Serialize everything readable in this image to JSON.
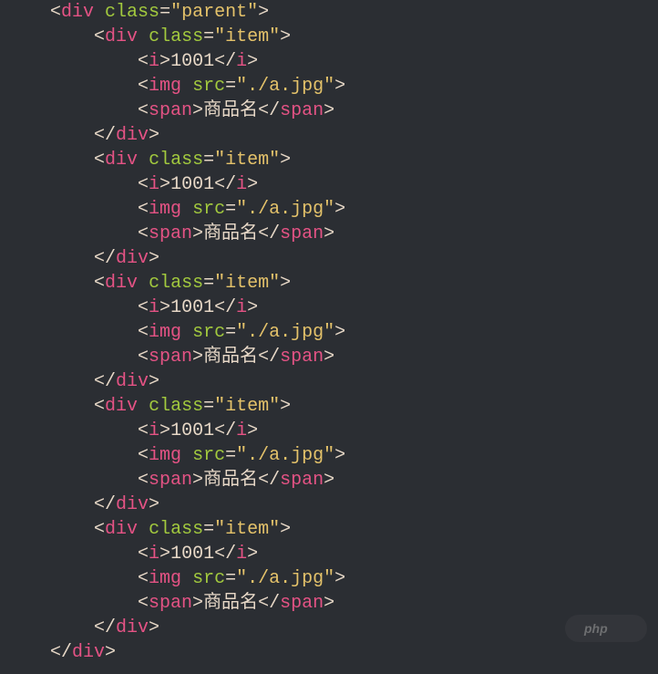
{
  "code": {
    "parent": {
      "tag": "div",
      "attr": "class",
      "val": "\"parent\""
    },
    "items": [
      {
        "tag": "div",
        "attr": "class",
        "val": "\"item\"",
        "i_tag": "i",
        "i_text": "1001",
        "img_tag": "img",
        "img_attr": "src",
        "img_val": "\"./a.jpg\"",
        "span_tag": "span",
        "span_text": "商品名"
      },
      {
        "tag": "div",
        "attr": "class",
        "val": "\"item\"",
        "i_tag": "i",
        "i_text": "1001",
        "img_tag": "img",
        "img_attr": "src",
        "img_val": "\"./a.jpg\"",
        "span_tag": "span",
        "span_text": "商品名"
      },
      {
        "tag": "div",
        "attr": "class",
        "val": "\"item\"",
        "i_tag": "i",
        "i_text": "1001",
        "img_tag": "img",
        "img_attr": "src",
        "img_val": "\"./a.jpg\"",
        "span_tag": "span",
        "span_text": "商品名"
      },
      {
        "tag": "div",
        "attr": "class",
        "val": "\"item\"",
        "i_tag": "i",
        "i_text": "1001",
        "img_tag": "img",
        "img_attr": "src",
        "img_val": "\"./a.jpg\"",
        "span_tag": "span",
        "span_text": "商品名"
      },
      {
        "tag": "div",
        "attr": "class",
        "val": "\"item\"",
        "i_tag": "i",
        "i_text": "1001",
        "img_tag": "img",
        "img_attr": "src",
        "img_val": "\"./a.jpg\"",
        "span_tag": "span",
        "span_text": "商品名"
      }
    ],
    "lt": "<",
    "gt": ">",
    "slash": "/",
    "eq": "=",
    "sp": " "
  },
  "watermark": {
    "text": "php"
  }
}
